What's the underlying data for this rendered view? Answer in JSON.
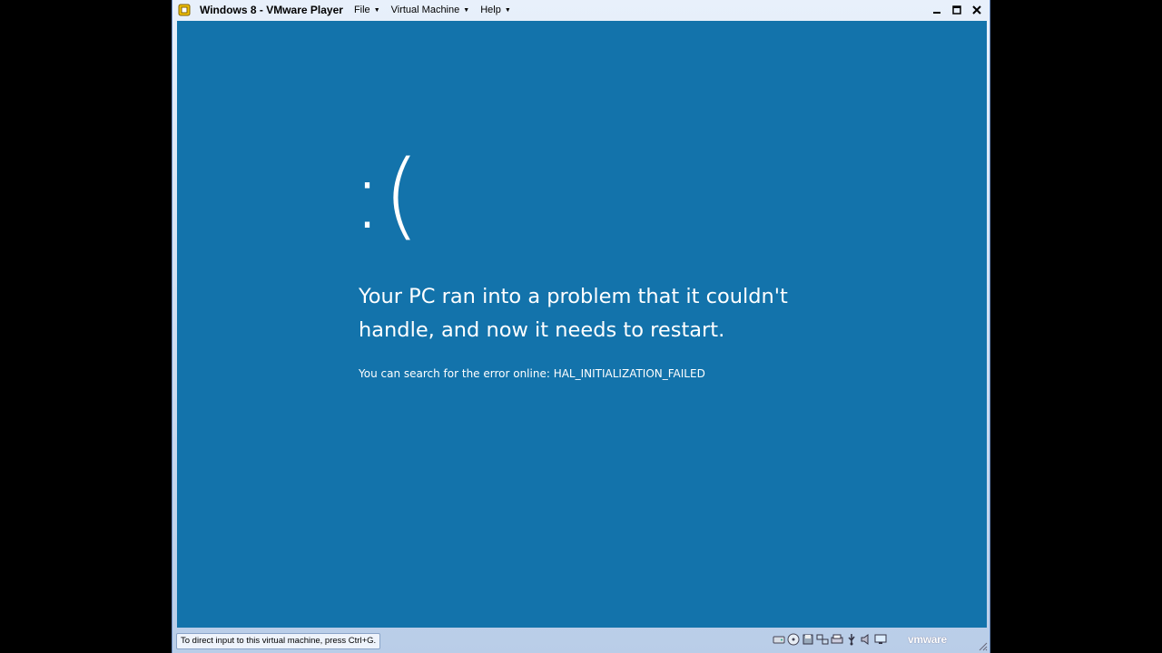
{
  "window": {
    "title": "Windows 8 - VMware Player",
    "menus": [
      {
        "label": "File",
        "icon": "chevron-down-icon"
      },
      {
        "label": "Virtual Machine",
        "icon": "chevron-down-icon"
      },
      {
        "label": "Help",
        "icon": "chevron-down-icon"
      }
    ],
    "controls": [
      "minimize-icon",
      "maximize-icon",
      "close-icon"
    ]
  },
  "bsod": {
    "face": ":(",
    "headline": "Your PC ran into a problem that it couldn't handle, and now it needs to restart.",
    "error_line": "You can search for the error online: HAL_INITIALIZATION_FAILED",
    "background": "#1373ab"
  },
  "statusbar": {
    "hint": "To direct input to this virtual machine, press Ctrl+G.",
    "device_icons": [
      "hard-disk-icon",
      "cd-icon",
      "floppy-icon",
      "network-icon",
      "printer-icon",
      "usb-icon",
      "sound-icon",
      "display-icon"
    ],
    "brand": "vmware"
  }
}
